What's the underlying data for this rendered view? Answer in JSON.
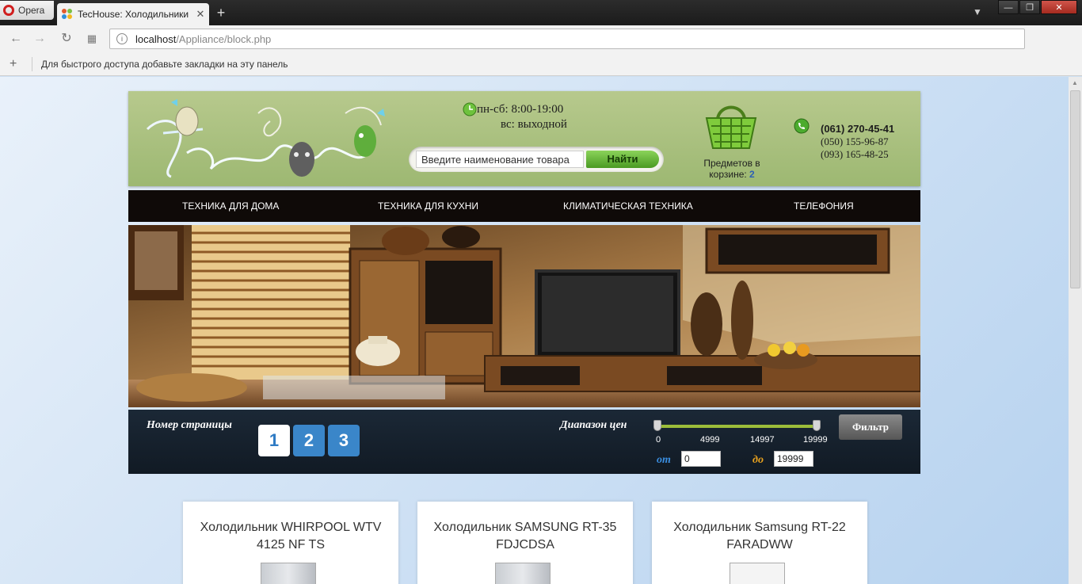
{
  "browser": {
    "menu_label": "Opera",
    "tab_title": "TecHouse: Холодильники",
    "url_host": "localhost",
    "url_path": "/Appliance/block.php",
    "bookmarks_hint": "Для быстрого доступа добавьте закладки на эту панель"
  },
  "header": {
    "hours_line1": "пн-сб: 8:00-19:00",
    "hours_line2": "вс: выходной",
    "search_placeholder": "Введите наименование товара",
    "search_button": "Найти",
    "cart_label": "Предметов в корзине:",
    "cart_count": "2",
    "phone_main": "(061) 270-45-41",
    "phone_2": "(050) 155-96-87",
    "phone_3": "(093) 165-48-25"
  },
  "nav": {
    "items": [
      {
        "label": "ТЕХНИКА ДЛЯ ДОМА"
      },
      {
        "label": "ТЕХНИКА ДЛЯ КУХНИ"
      },
      {
        "label": "КЛИМАТИЧЕСКАЯ ТЕХНИКА"
      },
      {
        "label": "ТЕЛЕФОНИЯ"
      }
    ]
  },
  "filter": {
    "page_label": "Номер страницы",
    "pages": [
      "1",
      "2",
      "3"
    ],
    "active_page": "1",
    "price_label": "Диапазон цен",
    "ticks": [
      "0",
      "4999",
      "14997",
      "19999"
    ],
    "from_label": "от",
    "to_label": "до",
    "from_value": "0",
    "to_value": "19999",
    "min_price": 0,
    "max_price": 19999,
    "button": "Фильтр"
  },
  "products": [
    {
      "title": "Холодильник WHIRPOOL WTV 4125 NF TS"
    },
    {
      "title": "Холодильник SAMSUNG RT-35 FDJCDSA"
    },
    {
      "title": "Холодильник Samsung RT-22 FARADWW"
    }
  ],
  "colors": {
    "header_green": "#a9c07f",
    "nav_bg": "#0f0a08",
    "filter_bg": "#16212d",
    "page_btn": "#3a86c9",
    "search_btn": "#6bb63e",
    "slider": "#9cbd3a"
  }
}
